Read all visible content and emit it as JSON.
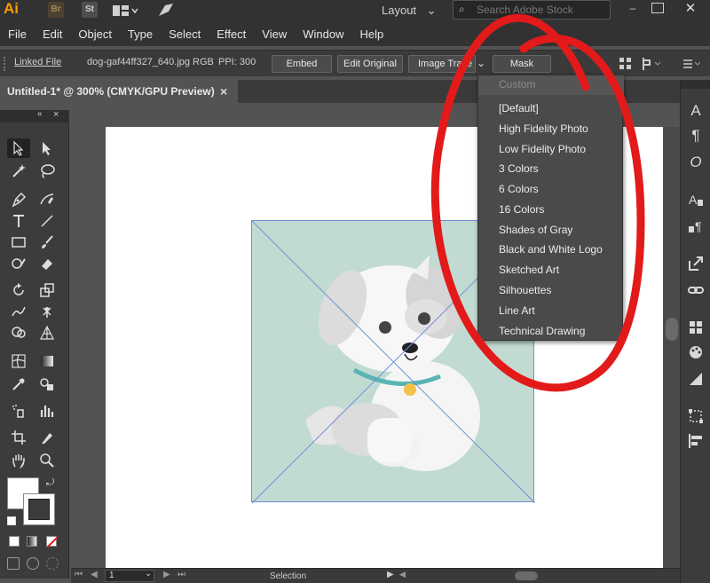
{
  "appbar": {
    "logo": "Ai",
    "br_badge": "Br",
    "st_badge": "St",
    "workspace_label": "Layout",
    "search_placeholder": "Search Adobe Stock"
  },
  "menubar": {
    "items": [
      "File",
      "Edit",
      "Object",
      "Type",
      "Select",
      "Effect",
      "View",
      "Window",
      "Help"
    ]
  },
  "control": {
    "linked_file_label": "Linked File",
    "file_name": "dog-gaf44ff327_640.jpg",
    "color_mode": "RGB",
    "ppi": "PPI: 300",
    "embed_label": "Embed",
    "edit_original_label": "Edit Original",
    "image_trace_label": "Image Trace",
    "mask_label": "Mask"
  },
  "document": {
    "tab_title": "Untitled-1* @ 300% (CMYK/GPU Preview)",
    "close_glyph": "×"
  },
  "trace_presets": {
    "header": "Custom",
    "items": [
      "[Default]",
      "High Fidelity Photo",
      "Low Fidelity Photo",
      "3 Colors",
      "6 Colors",
      "16 Colors",
      "Shades of Gray",
      "Black and White Logo",
      "Sketched Art",
      "Silhouettes",
      "Line Art",
      "Technical Drawing"
    ]
  },
  "status": {
    "zoom_value": "1",
    "tool_name": "Selection"
  },
  "colors": {
    "frame_fill": "#c2dbd2",
    "annotation_red": "#e21a1a",
    "selection_blue": "#6f8fd6",
    "app_accent": "#ff9a00"
  },
  "dock": {
    "char_icon": "A",
    "para_icon": "¶",
    "glyph_icon": "O"
  }
}
